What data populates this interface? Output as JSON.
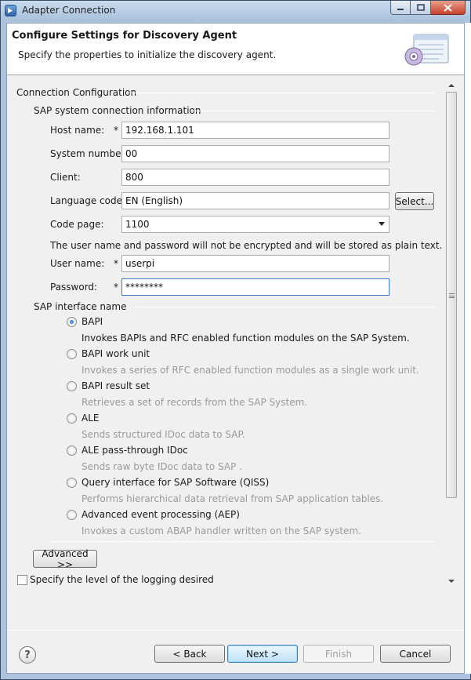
{
  "window": {
    "title": "Adapter Connection"
  },
  "banner": {
    "title": "Configure Settings for Discovery Agent",
    "description": "Specify the properties to initialize the discovery agent."
  },
  "connection": {
    "group_title": "Connection Configuration",
    "sap_group_title": "SAP system connection information",
    "required_mark": "*",
    "host": {
      "label": "Host name:",
      "value": "192.168.1.101"
    },
    "system_number": {
      "label": "System number:",
      "value": "00"
    },
    "client": {
      "label": "Client:",
      "value": "800"
    },
    "language": {
      "label": "Language code:",
      "value": "EN (English)",
      "button": "Select..."
    },
    "code_page": {
      "label": "Code page:",
      "value": "1100"
    },
    "warning": "The user name and password will not be encrypted and will be stored as plain text.",
    "user": {
      "label": "User name:",
      "value": "userpi"
    },
    "password": {
      "label": "Password:",
      "value": "********"
    }
  },
  "interface": {
    "group_title": "SAP interface name",
    "options": [
      {
        "label": "BAPI",
        "desc": "Invokes BAPIs and RFC enabled function modules on the SAP System.",
        "checked": true
      },
      {
        "label": "BAPI work unit",
        "desc": "Invokes a series of RFC enabled function modules as a single work unit.",
        "checked": false
      },
      {
        "label": "BAPI result set",
        "desc": "Retrieves a set of records from the SAP System.",
        "checked": false
      },
      {
        "label": "ALE",
        "desc": "Sends structured IDoc data to SAP.",
        "checked": false
      },
      {
        "label": "ALE pass-through IDoc",
        "desc": "Sends raw byte IDoc data to SAP .",
        "checked": false
      },
      {
        "label": "Query interface for SAP Software (QISS)",
        "desc": "Performs hierarchical data retrieval from SAP application tables.",
        "checked": false
      },
      {
        "label": "Advanced event processing (AEP)",
        "desc": "Invokes a custom ABAP handler written on the SAP system.",
        "checked": false
      }
    ]
  },
  "advanced_button": "Advanced >>",
  "logging_checkbox": {
    "label": "Specify the level of the logging desired",
    "checked": false
  },
  "footer": {
    "help": "?",
    "back": "< Back",
    "next": "Next >",
    "finish": "Finish",
    "cancel": "Cancel"
  }
}
